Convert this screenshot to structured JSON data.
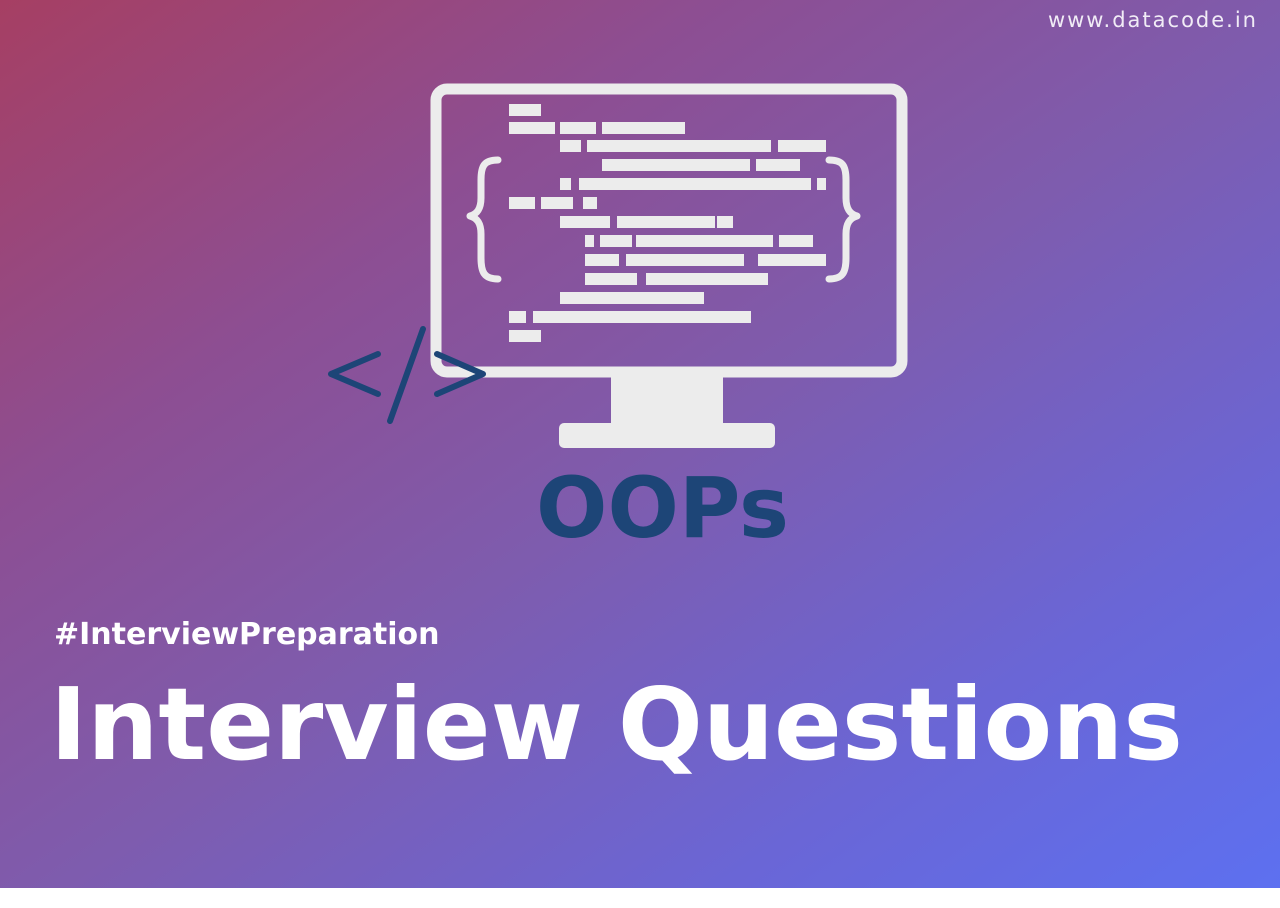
{
  "site_url": "www.datacode.in",
  "topic_title": "OOPs",
  "hashtag": "#InterviewPreparation",
  "headline": "Interview Questions",
  "colors": {
    "gradient_start": "#a63f63",
    "gradient_end": "#5d70f0",
    "monitor": "#ececec",
    "accent_navy": "#1d4577",
    "text_white": "#ffffff"
  },
  "icons": [
    "monitor-icon",
    "code-tag-icon",
    "curly-braces-icon"
  ]
}
